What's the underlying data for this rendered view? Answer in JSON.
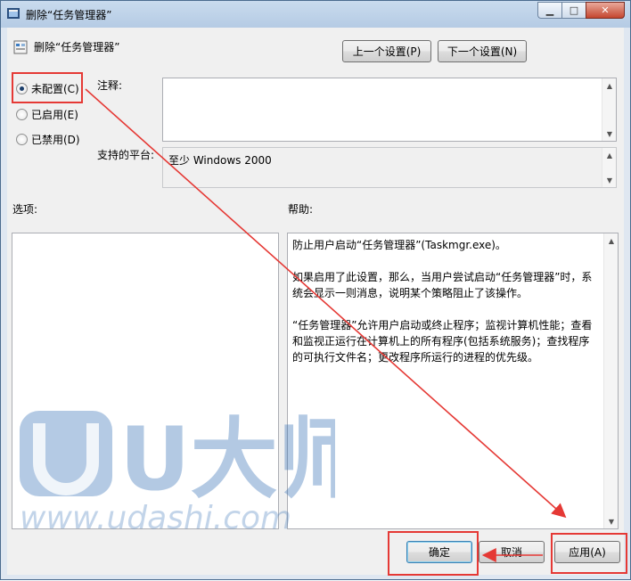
{
  "window": {
    "title": "删除“任务管理器”",
    "controls": {
      "minimize": "▁",
      "maximize": "□",
      "close": "✕"
    }
  },
  "header": {
    "policy_name": "删除“任务管理器”",
    "prev_button": "上一个设置(P)",
    "next_button": "下一个设置(N)"
  },
  "state": {
    "options": [
      {
        "label": "未配置(C)",
        "selected": true
      },
      {
        "label": "已启用(E)",
        "selected": false
      },
      {
        "label": "已禁用(D)",
        "selected": false
      }
    ]
  },
  "comment": {
    "label": "注释:",
    "value": ""
  },
  "platform": {
    "label": "支持的平台:",
    "value": "至少 Windows 2000"
  },
  "options_section": {
    "label": "选项:"
  },
  "help_section": {
    "label": "帮助:",
    "text": "防止用户启动“任务管理器”(Taskmgr.exe)。\n\n如果启用了此设置，那么，当用户尝试启动“任务管理器”时，系统会显示一则消息，说明某个策略阻止了该操作。\n\n“任务管理器”允许用户启动或终止程序；监视计算机性能；查看和监视正运行在计算机上的所有程序(包括系统服务)；查找程序的可执行文件名；更改程序所运行的进程的优先级。"
  },
  "footer": {
    "ok_button": "确定",
    "cancel_button": "取消",
    "apply_button": "应用(A)"
  },
  "watermark": {
    "brand": "U大师",
    "url": "www.udashi.com"
  },
  "colors": {
    "annotation_red": "#e53935",
    "window_frame": "#dfe7f1",
    "watermark_blue": "#3a74b8"
  }
}
